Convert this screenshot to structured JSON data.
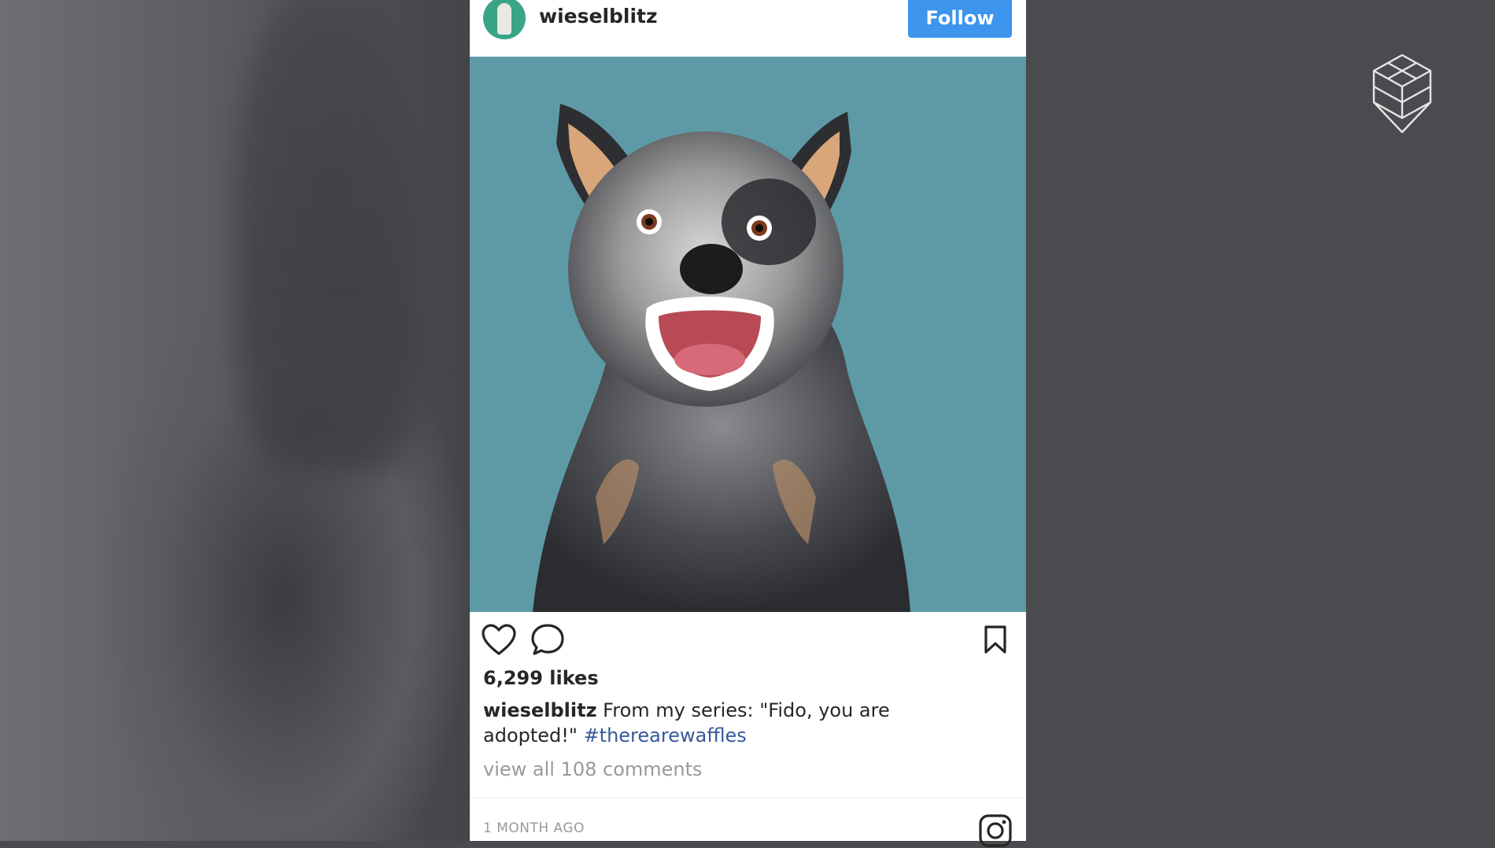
{
  "post": {
    "username": "wieselblitz",
    "follow_label": "Follow",
    "likes": "6,299 likes",
    "caption_user": "wieselblitz",
    "caption_text": " From my series: \"Fido, you are adopted!\" ",
    "hashtag": "#therearewaffles",
    "comments_link": "view all 108 comments",
    "timestamp": "1 MONTH AGO"
  },
  "icons": {
    "like": "heart-icon",
    "comment": "speech-bubble-icon",
    "save": "bookmark-icon",
    "instagram": "instagram-glyph-icon",
    "brand": "geometric-cube-logo"
  },
  "colors": {
    "follow_button": "#3d95ee",
    "hashtag": "#36589a",
    "photo_background": "#5e9aa6",
    "page_background": "#4a4b4f"
  }
}
